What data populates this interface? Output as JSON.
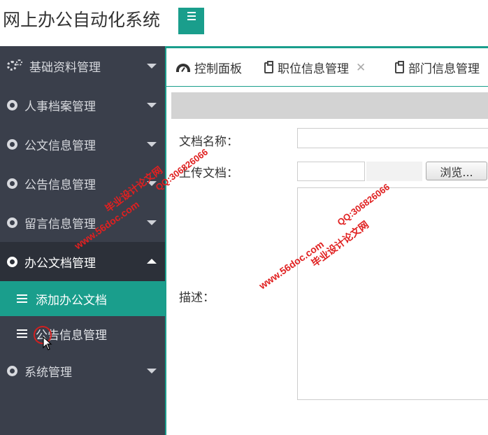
{
  "app": {
    "title": "网上办公自动化系统"
  },
  "sidebar": {
    "items": [
      {
        "label": "基础资料管理",
        "icon": "gears-icon"
      },
      {
        "label": "人事档案管理",
        "icon": "circle-icon"
      },
      {
        "label": "公文信息管理",
        "icon": "circle-icon"
      },
      {
        "label": "公告信息管理",
        "icon": "circle-icon"
      },
      {
        "label": "留言信息管理",
        "icon": "circle-icon"
      },
      {
        "label": "办公文档管理",
        "icon": "circle-icon",
        "expanded": true
      },
      {
        "label": "系统管理",
        "icon": "circle-icon"
      }
    ],
    "subitems": [
      {
        "label": "添加办公文档",
        "active": true
      },
      {
        "label": "公告信息管理",
        "active": false
      }
    ]
  },
  "tabs": [
    {
      "label": "控制面板",
      "icon": "dashboard-icon"
    },
    {
      "label": "职位信息管理",
      "icon": "clipboard-icon",
      "closable": true
    },
    {
      "label": "部门信息管理",
      "icon": "clipboard-icon"
    }
  ],
  "form": {
    "doc_name_label": "文档名称：",
    "upload_label": "上传文档：",
    "browse_button": "浏览...",
    "description_label": "描述："
  },
  "watermarks": {
    "site": "www.56doc.com",
    "qq": "QQ:306826066",
    "brand": "毕业设计论文网"
  },
  "colors": {
    "accent": "#1a9e8c",
    "sidebar_bg": "#3a3f4b",
    "watermark": "#e02020"
  }
}
